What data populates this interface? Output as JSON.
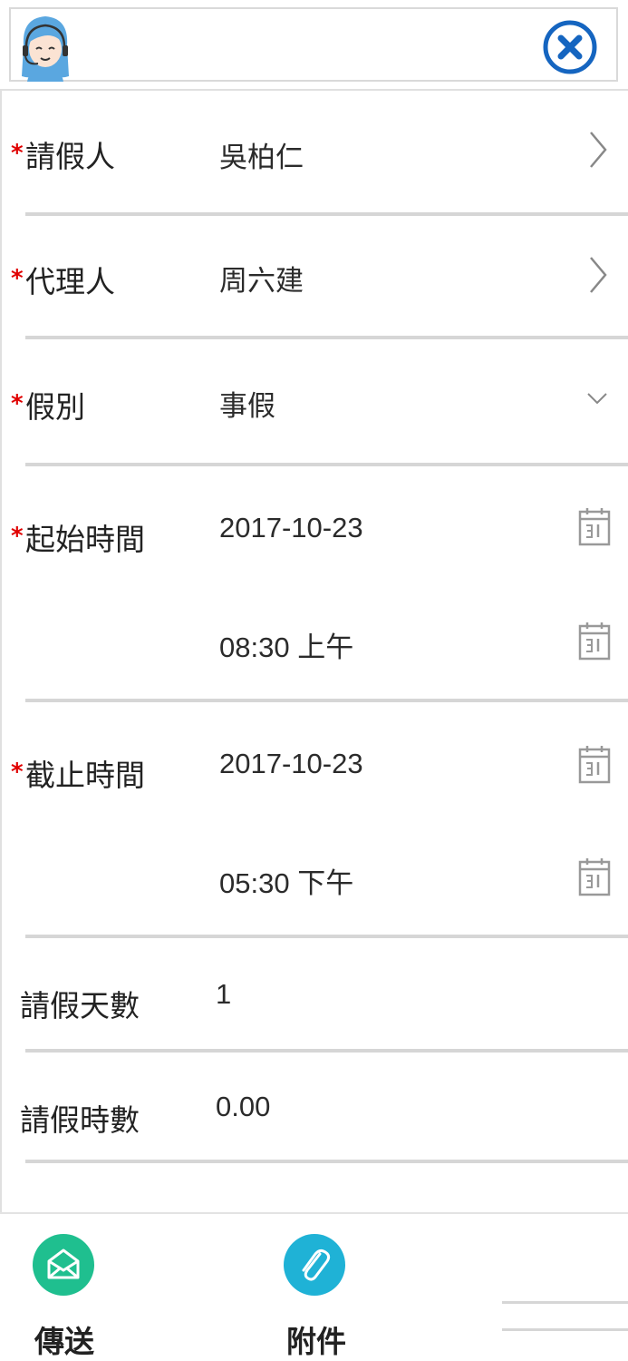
{
  "header": {
    "avatar_icon": "support-agent-icon",
    "close_icon": "close-circle-icon",
    "accent_color": "#1565c0"
  },
  "form": {
    "required_mark": "*",
    "applicant": {
      "label": "請假人",
      "value": "吳柏仁",
      "icon": "chevron-right-icon"
    },
    "agent": {
      "label": "代理人",
      "value": "周六建",
      "icon": "chevron-right-icon"
    },
    "leave_type": {
      "label": "假別",
      "value": "事假",
      "icon": "chevron-down-icon"
    },
    "start_time": {
      "label": "起始時間",
      "date": "2017-10-23",
      "time": "08:30 上午",
      "icon": "calendar-icon"
    },
    "end_time": {
      "label": "截止時間",
      "date": "2017-10-23",
      "time": "05:30 下午",
      "icon": "calendar-icon"
    },
    "leave_days": {
      "label": "請假天數",
      "value": "1"
    },
    "leave_hours": {
      "label": "請假時數",
      "value": "0.00"
    }
  },
  "bottom_bar": {
    "send_label": "傳送",
    "send_icon": "envelope-icon",
    "send_color": "#1fbf8f",
    "attach_label": "附件",
    "attach_icon": "paperclip-icon",
    "attach_color": "#1fb2d6"
  }
}
